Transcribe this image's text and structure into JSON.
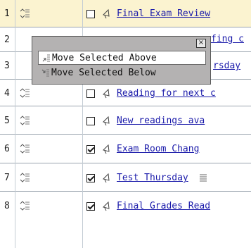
{
  "rows": [
    {
      "num": "1",
      "title": "Final Exam Review",
      "checked": false,
      "highlight": true
    },
    {
      "num": "2",
      "title": "fing c",
      "checked": false,
      "highlight": false
    },
    {
      "num": "3",
      "title": "rsday",
      "checked": false,
      "highlight": false
    },
    {
      "num": "4",
      "title": "Reading for next c",
      "checked": false,
      "highlight": false
    },
    {
      "num": "5",
      "title": "New readings ava",
      "checked": false,
      "highlight": false
    },
    {
      "num": "6",
      "title": "Exam Room Chang",
      "checked": true,
      "highlight": false
    },
    {
      "num": "7",
      "title": "Test Thursday",
      "checked": true,
      "highlight": false
    },
    {
      "num": "8",
      "title": "Final Grades Read",
      "checked": true,
      "highlight": false
    }
  ],
  "popup": {
    "close_label": "×",
    "items": [
      {
        "label": "Move Selected Above",
        "icon": "move-above-icon",
        "selected": true
      },
      {
        "label": "Move Selected Below",
        "icon": "move-below-icon",
        "selected": false
      }
    ]
  },
  "colors": {
    "link": "#1a1aaa",
    "highlight": "#fbf3d0",
    "popup_bg": "#b4b2b2"
  }
}
